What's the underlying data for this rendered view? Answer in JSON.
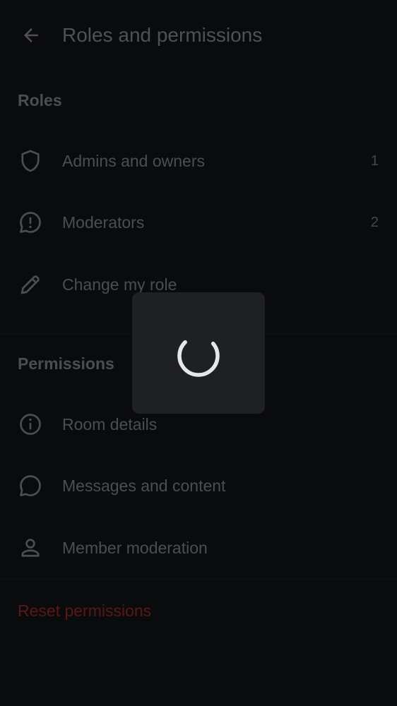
{
  "header": {
    "title": "Roles and permissions",
    "back_icon": "arrow-left-icon"
  },
  "roles": {
    "header": "Roles",
    "items": [
      {
        "label": "Admins and owners",
        "count": "1",
        "icon": "shield-icon"
      },
      {
        "label": "Moderators",
        "count": "2",
        "icon": "chat-alert-icon"
      },
      {
        "label": "Change my role",
        "icon": "pencil-icon"
      }
    ]
  },
  "permissions": {
    "header": "Permissions",
    "items": [
      {
        "label": "Room details",
        "icon": "info-icon"
      },
      {
        "label": "Messages and content",
        "icon": "chat-bubble-icon"
      },
      {
        "label": "Member moderation",
        "icon": "user-icon"
      }
    ]
  },
  "reset": {
    "label": "Reset permissions"
  },
  "colors": {
    "background": "#101214",
    "text": "#74777c",
    "danger": "#8a2226",
    "dialog": "#1f2024",
    "spinner": "#e6e7e9"
  },
  "loading": {
    "visible": true
  }
}
